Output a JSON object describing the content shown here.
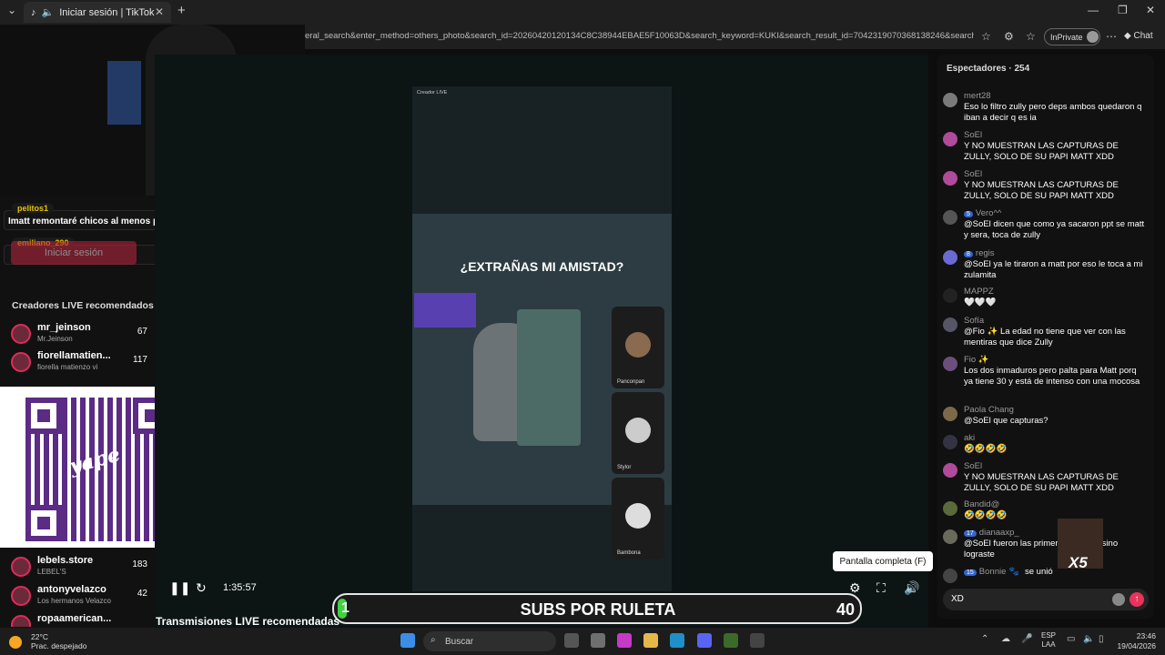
{
  "browser": {
    "tab_title": "Iniciar sesión | TikTok",
    "url": "eral_search&enter_method=others_photo&search_id=20260420120134C8C38944EBAE5F10063D&search_keyword=KUKI&search_result_id=7042319070368138246&search_typ...",
    "inprivate_label": "InPrivate",
    "chat_label": "Chat"
  },
  "overlay": {
    "comments": [
      {
        "user": "pelitos1",
        "text": "Imatt remontaré chicos al menos para limpiarme de esto"
      },
      {
        "user": "emiliano_290",
        "text": ""
      }
    ],
    "login_button": "Iniciar sesión",
    "banner_left": "1",
    "banner_text": "SUBS POR RULETA",
    "banner_right": "40"
  },
  "sidebar": {
    "recommended_title": "Creadores LIVE recomendados",
    "creators": [
      {
        "name": "mr_jeinson",
        "sub": "Mr.Jeinson",
        "count": "67"
      },
      {
        "name": "fiorellamatien...",
        "sub": "fiorella matienzo vi",
        "count": "117"
      },
      {
        "name": "lebels.store",
        "sub": "LEBEL'S",
        "count": "183"
      },
      {
        "name": "antonyvelazco",
        "sub": "Los hermanos Velazco",
        "count": "42"
      },
      {
        "name": "ropaamerican...",
        "sub": "",
        "count": ""
      }
    ],
    "qr_brand": "yape"
  },
  "player": {
    "creator_label": "Creador LIVE",
    "video_title": "¿EXTRAÑAS MI AMISTAD?",
    "guests": [
      {
        "name": "Panconpan"
      },
      {
        "name": "Stylor"
      },
      {
        "name": "Bambona"
      }
    ],
    "time": "1:35:57",
    "tooltip": "Pantalla completa (F)",
    "recommended_below": "Transmisiones LIVE recomendadas"
  },
  "chat": {
    "header": "Espectadores · 254",
    "messages": [
      {
        "user": "mert28",
        "level": "",
        "text": "Eso lo filtro zully pero deps ambos quedaron q iban a decir q es ia"
      },
      {
        "user": "SoEl",
        "level": "",
        "text": "Y NO MUESTRAN LAS CAPTURAS DE ZULLY, SOLO DE SU PAPI MATT XDD"
      },
      {
        "user": "SoEl",
        "level": "",
        "text": "Y NO MUESTRAN LAS CAPTURAS DE ZULLY, SOLO DE SU PAPI MATT XDD"
      },
      {
        "user": "Vero^^",
        "level": "5",
        "text": "@SoEl dicen que como ya sacaron ppt se matt y sera, toca de zully"
      },
      {
        "user": "regis",
        "level": "8",
        "text": "@SoEl ya le tiraron a matt por eso le toca a mi zulamita"
      },
      {
        "user": "MAPPZ",
        "level": "",
        "text": "🤍🤍🤍"
      },
      {
        "user": "Sofía",
        "level": "",
        "text": "@Fio ✨ La edad no tiene que ver con las mentiras que dice Zully"
      },
      {
        "user": "Fio ✨",
        "level": "",
        "text": "Los dos inmaduros pero palta para Matt porq ya tiene 30 y está de intenso con una mocosa"
      },
      {
        "user": "Paola Chang",
        "level": "",
        "text": "@SoEl que capturas?"
      },
      {
        "user": "aki",
        "level": "",
        "text": "🤣🤣🤣🤣"
      },
      {
        "user": "SoEl",
        "level": "",
        "text": "Y NO MUESTRAN LAS CAPTURAS DE ZULLY, SOLO DE SU PAPI MATT XDD"
      },
      {
        "user": "Bandid@",
        "level": "",
        "text": "🤣🤣🤣🤣"
      },
      {
        "user": "dianaaxp_",
        "level": "17",
        "text": "@SoEl fueron las primer mostraron sino lograste"
      },
      {
        "user": "Bonnie 🐾",
        "level": "15",
        "text": "se unió"
      }
    ],
    "input_value": "XD",
    "gift_multiplier": "X5"
  },
  "taskbar": {
    "temperature": "22°C",
    "weather": "Prac. despejado",
    "search_placeholder": "Buscar",
    "lang_top": "ESP",
    "lang_bottom": "LAA",
    "time": "23:46",
    "date": "19/04/2026"
  }
}
